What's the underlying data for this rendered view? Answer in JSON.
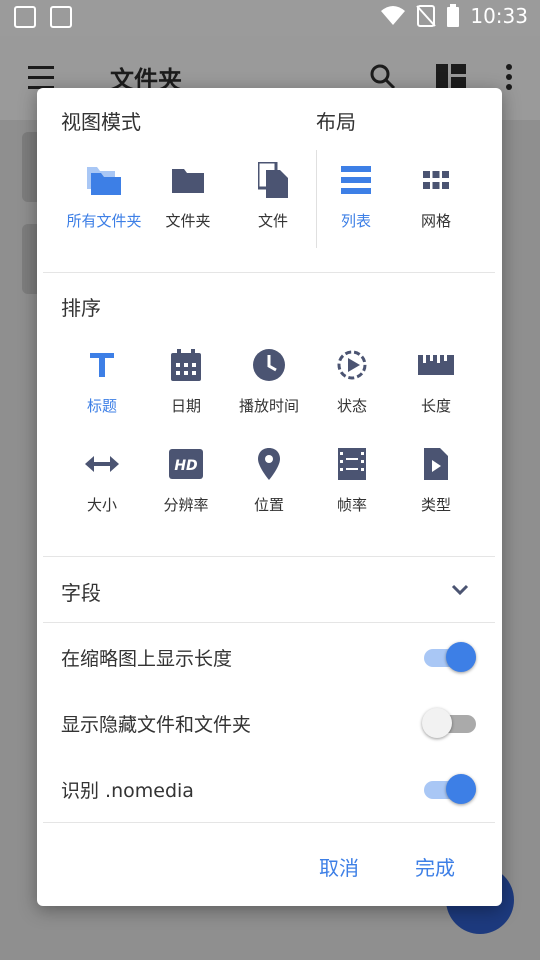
{
  "statusbar": {
    "time": "10:33"
  },
  "appbar": {
    "title": "文件夹"
  },
  "dialog": {
    "view_mode": {
      "title": "视图模式",
      "options": [
        {
          "label": "所有文件夹",
          "icon": "folders-icon",
          "selected": true
        },
        {
          "label": "文件夹",
          "icon": "folder-icon",
          "selected": false
        },
        {
          "label": "文件",
          "icon": "file-copy-icon",
          "selected": false
        }
      ]
    },
    "layout": {
      "title": "布局",
      "options": [
        {
          "label": "列表",
          "icon": "list-icon",
          "selected": true
        },
        {
          "label": "网格",
          "icon": "grid-icon",
          "selected": false
        }
      ]
    },
    "sort": {
      "title": "排序",
      "options": [
        {
          "label": "标题",
          "icon": "title-T-icon",
          "selected": true
        },
        {
          "label": "日期",
          "icon": "calendar-icon",
          "selected": false
        },
        {
          "label": "播放时间",
          "icon": "clock-icon",
          "selected": false
        },
        {
          "label": "状态",
          "icon": "play-status-icon",
          "selected": false
        },
        {
          "label": "长度",
          "icon": "ruler-icon",
          "selected": false
        },
        {
          "label": "大小",
          "icon": "resize-arrows-icon",
          "selected": false
        },
        {
          "label": "分辨率",
          "icon": "hd-icon",
          "selected": false
        },
        {
          "label": "位置",
          "icon": "location-pin-icon",
          "selected": false
        },
        {
          "label": "帧率",
          "icon": "film-icon",
          "selected": false
        },
        {
          "label": "类型",
          "icon": "video-file-icon",
          "selected": false
        }
      ]
    },
    "fields": {
      "title": "字段"
    },
    "toggles": [
      {
        "label": "在缩略图上显示长度",
        "on": true
      },
      {
        "label": "显示隐藏文件和文件夹",
        "on": false
      },
      {
        "label": "识别 .nomedia",
        "on": true
      }
    ],
    "buttons": {
      "cancel": "取消",
      "ok": "完成"
    }
  },
  "colors": {
    "accent": "#3d7fe6",
    "icon": "#4b5472"
  }
}
